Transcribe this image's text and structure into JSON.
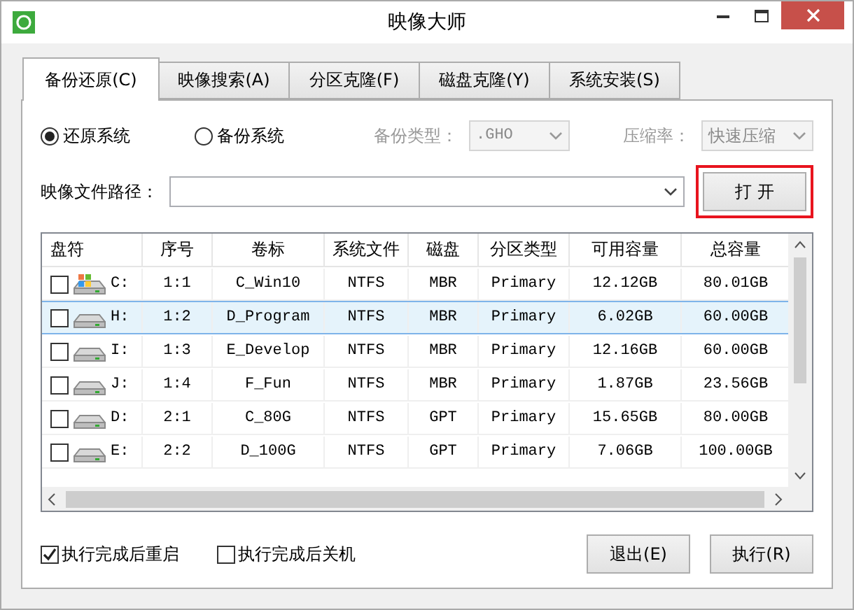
{
  "window": {
    "title": "映像大师"
  },
  "tabs": [
    {
      "label": "备份还原(C)",
      "selected": true
    },
    {
      "label": "映像搜索(A)",
      "selected": false
    },
    {
      "label": "分区克隆(F)",
      "selected": false
    },
    {
      "label": "磁盘克隆(Y)",
      "selected": false
    },
    {
      "label": "系统安装(S)",
      "selected": false
    }
  ],
  "modes": [
    {
      "label": "还原系统",
      "selected": true
    },
    {
      "label": "备份系统",
      "selected": false
    }
  ],
  "backup_type": {
    "label": "备份类型：",
    "value": ".GHO",
    "disabled": true
  },
  "compression": {
    "label": "压缩率：",
    "value": "快速压缩",
    "disabled": true
  },
  "image_path": {
    "label": "映像文件路径："
  },
  "open_button": {
    "label": "打 开",
    "highlighted": true
  },
  "table": {
    "columns": [
      "盘符",
      "序号",
      "卷标",
      "系统文件",
      "磁盘",
      "分区类型",
      "可用容量",
      "总容量"
    ],
    "rows": [
      {
        "kind": "system",
        "checked": false,
        "selected": false,
        "cells": [
          "C:",
          "1:1",
          "C_Win10",
          "NTFS",
          "MBR",
          "Primary",
          "12.12GB",
          "80.01GB"
        ]
      },
      {
        "kind": "drive",
        "checked": false,
        "selected": true,
        "cells": [
          "H:",
          "1:2",
          "D_Program",
          "NTFS",
          "MBR",
          "Primary",
          "6.02GB",
          "60.00GB"
        ]
      },
      {
        "kind": "drive",
        "checked": false,
        "selected": false,
        "cells": [
          "I:",
          "1:3",
          "E_Develop",
          "NTFS",
          "MBR",
          "Primary",
          "12.16GB",
          "60.00GB"
        ]
      },
      {
        "kind": "drive",
        "checked": false,
        "selected": false,
        "cells": [
          "J:",
          "1:4",
          "F_Fun",
          "NTFS",
          "MBR",
          "Primary",
          "1.87GB",
          "23.56GB"
        ]
      },
      {
        "kind": "drive",
        "checked": false,
        "selected": false,
        "cells": [
          "D:",
          "2:1",
          "C_80G",
          "NTFS",
          "GPT",
          "Primary",
          "15.65GB",
          "80.00GB"
        ]
      },
      {
        "kind": "drive",
        "checked": false,
        "selected": false,
        "cells": [
          "E:",
          "2:2",
          "D_100G",
          "NTFS",
          "GPT",
          "Primary",
          "7.06GB",
          "100.00GB"
        ]
      }
    ]
  },
  "options": [
    {
      "label": "执行完成后重启",
      "checked": true
    },
    {
      "label": "执行完成后关机",
      "checked": false
    }
  ],
  "buttons": [
    "退出(E)",
    "执行(R)"
  ]
}
